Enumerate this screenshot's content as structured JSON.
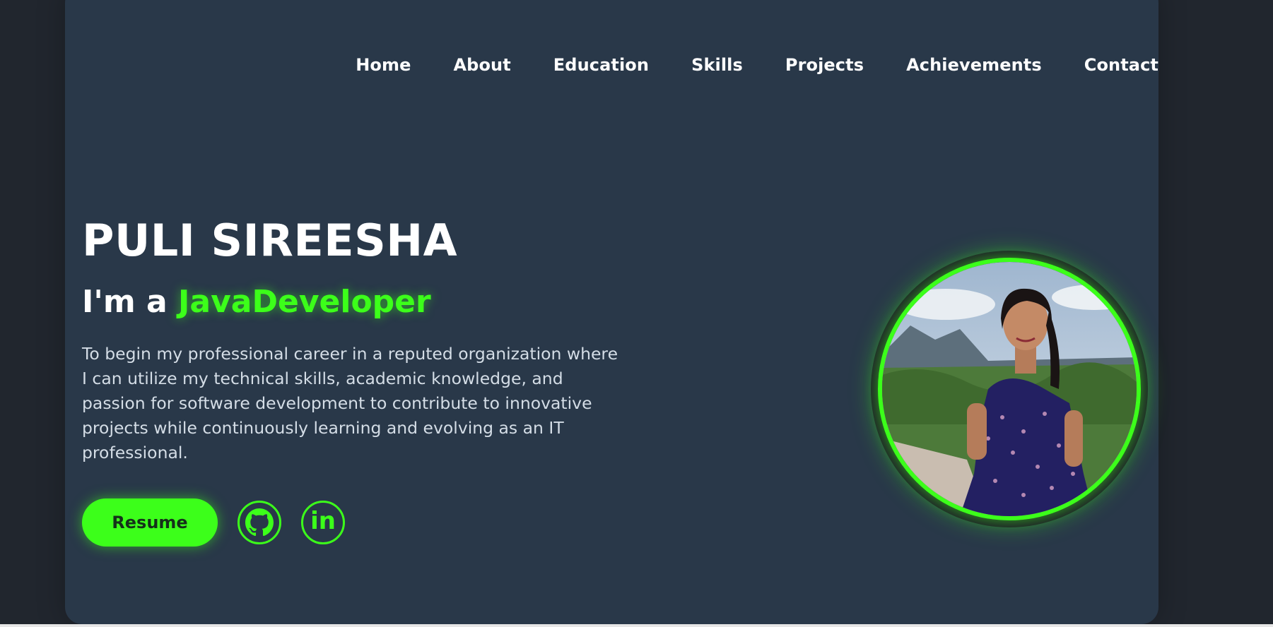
{
  "nav": {
    "items": [
      {
        "label": "Home"
      },
      {
        "label": "About"
      },
      {
        "label": "Education"
      },
      {
        "label": "Skills"
      },
      {
        "label": "Projects"
      },
      {
        "label": "Achievements"
      },
      {
        "label": "Contact"
      }
    ]
  },
  "hero": {
    "name": "PULI SIREESHA",
    "role_prefix": "I'm a ",
    "role_highlight": "JavaDeveloper",
    "description": "To begin my professional career in a reputed organization where I can utilize my technical skills, academic knowledge, and passion for software development to contribute to innovative projects while continuously learning and evolving as an IT professional.",
    "resume_label": "Resume",
    "linkedin_label": "in"
  },
  "icons": {
    "github": "github-icon",
    "linkedin": "linkedin-icon"
  },
  "colors": {
    "accent": "#3cff1a",
    "card_bg": "#293849",
    "page_bg": "#21262e",
    "text_primary": "#ffffff",
    "text_secondary": "#d4dde6"
  }
}
